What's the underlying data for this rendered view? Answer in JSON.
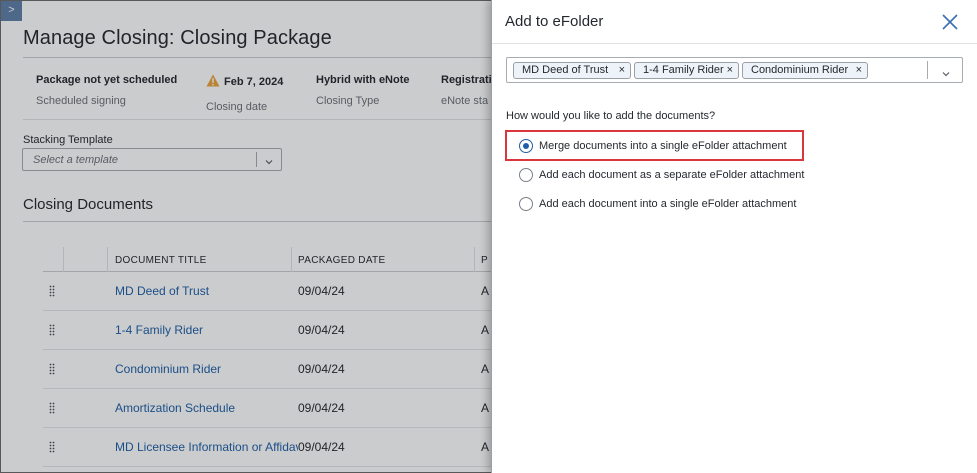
{
  "page": {
    "expand_glyph": ">",
    "title": "Manage Closing: Closing Package",
    "info": [
      {
        "value": "Package not yet scheduled",
        "label": "Scheduled signing"
      },
      {
        "value": "Feb 7, 2024",
        "label": "Closing date"
      },
      {
        "value": "Hybrid with eNote",
        "label": "Closing Type"
      },
      {
        "value": "Registrati",
        "label": "eNote sta"
      }
    ],
    "stacking": {
      "label": "Stacking Template",
      "placeholder": "Select a template"
    },
    "section_title": "Closing Documents",
    "table": {
      "headers": [
        "DOCUMENT TITLE",
        "PACKAGED DATE",
        "P"
      ],
      "rows": [
        {
          "title": "MD Deed of Trust",
          "date": "09/04/24",
          "cut": "A"
        },
        {
          "title": "1-4 Family Rider",
          "date": "09/04/24",
          "cut": "A"
        },
        {
          "title": "Condominium Rider",
          "date": "09/04/24",
          "cut": "A"
        },
        {
          "title": "Amortization Schedule",
          "date": "09/04/24",
          "cut": "A"
        },
        {
          "title": "MD Licensee Information or Affidavit",
          "date": "09/04/24",
          "cut": "A"
        }
      ]
    }
  },
  "panel": {
    "title": "Add to eFolder",
    "selected_docs": [
      {
        "label": "MD Deed of Trust",
        "remove": "×"
      },
      {
        "label": "1-4 Family Rider",
        "remove": "×"
      },
      {
        "label": "Condominium Rider",
        "remove": "×"
      }
    ],
    "question": "How would you like to add the documents?",
    "options": [
      {
        "label": "Merge documents into a single eFolder attachment",
        "selected": true
      },
      {
        "label": "Add each document as a separate eFolder attachment",
        "selected": false
      },
      {
        "label": "Add each document into a single eFolder attachment",
        "selected": false
      }
    ]
  },
  "colors": {
    "link": "#1f5fa8",
    "highlight": "#d9363e",
    "warning": "#e8a33a"
  }
}
